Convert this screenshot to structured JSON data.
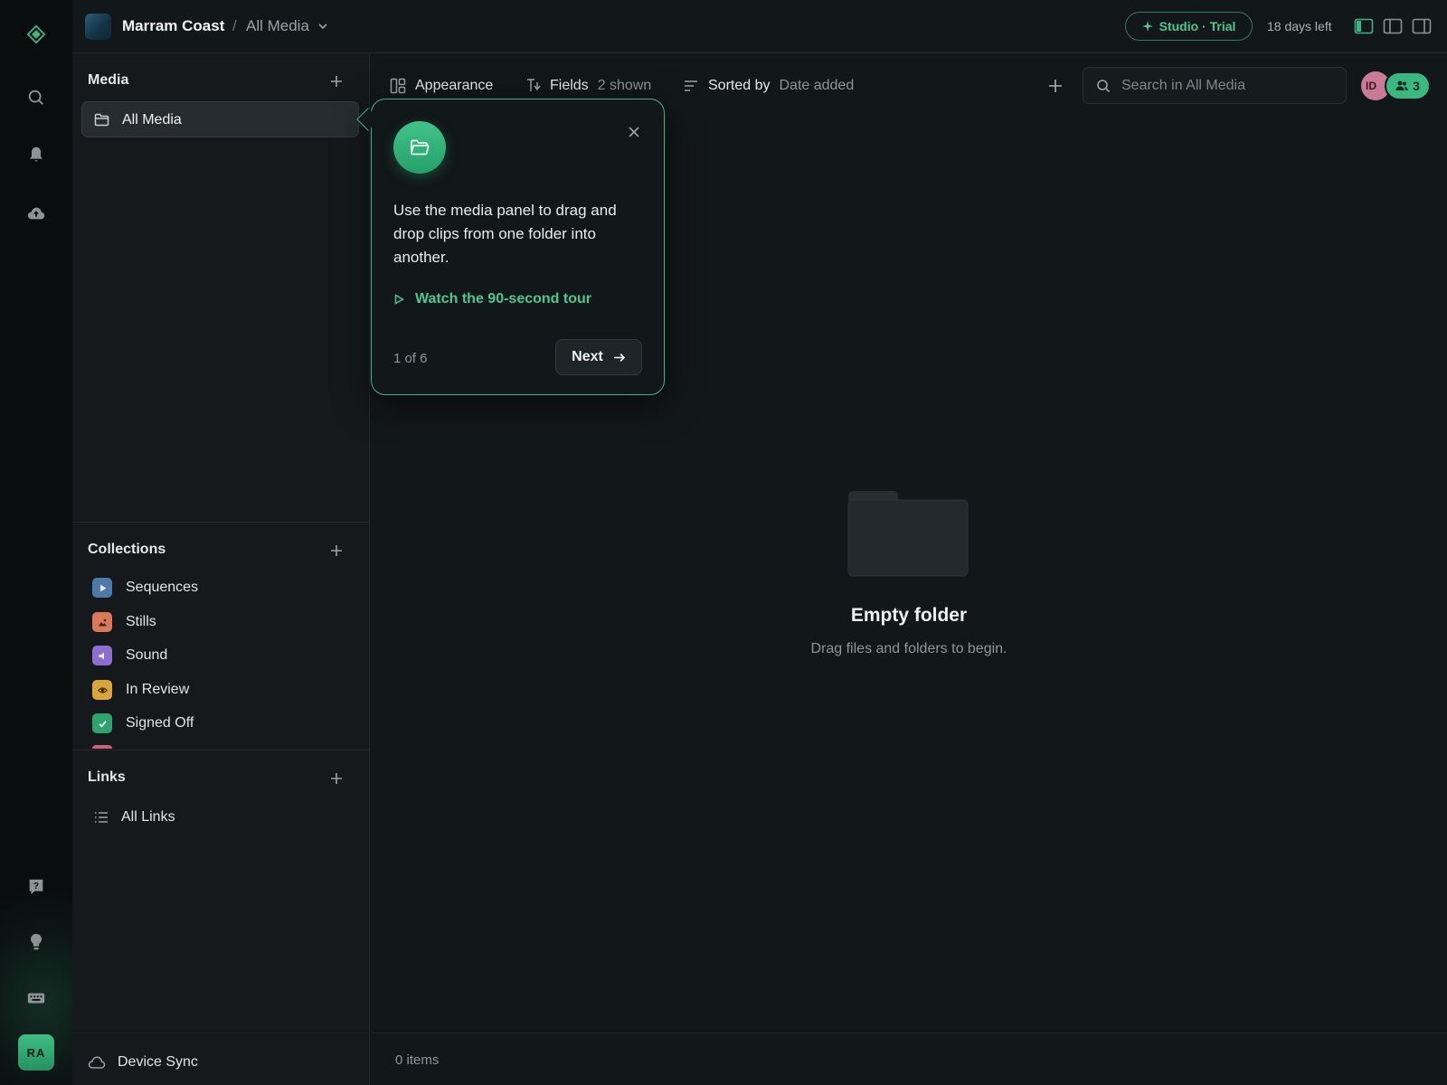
{
  "topbar": {
    "project": "Marram Coast",
    "separator": "/",
    "current": "All Media",
    "trial_label": "Studio · Trial",
    "days_left": "18 days left"
  },
  "rail": {
    "icons": [
      "logo-icon",
      "search-icon",
      "bell-icon",
      "cloud-upload-icon",
      "help-icon",
      "lightbulb-icon",
      "keyboard-icon"
    ],
    "user_initials": "RA"
  },
  "sidebar": {
    "media_title": "Media",
    "all_media": "All Media",
    "collections_title": "Collections",
    "collections": [
      {
        "label": "Sequences",
        "color": "#4d7aa6",
        "icon": "play-icon"
      },
      {
        "label": "Stills",
        "color": "#d9795a",
        "icon": "image-icon"
      },
      {
        "label": "Sound",
        "color": "#8a6fcf",
        "icon": "speaker-icon"
      },
      {
        "label": "In Review",
        "color": "#d9a63a",
        "icon": "eye-icon"
      },
      {
        "label": "Signed Off",
        "color": "#2fa36e",
        "icon": "check-icon"
      }
    ],
    "links_title": "Links",
    "all_links": "All Links",
    "device_sync": "Device Sync"
  },
  "toolbar": {
    "appearance": "Appearance",
    "fields_label": "Fields",
    "fields_value": "2 shown",
    "sorted_label": "Sorted by",
    "sorted_value": "Date added",
    "search_placeholder": "Search in All Media",
    "avatar_initials": "ID",
    "member_count": "3"
  },
  "empty": {
    "title": "Empty folder",
    "subtitle": "Drag files and folders to begin."
  },
  "status": {
    "item_count": "0 items"
  },
  "coachmark": {
    "body": "Use the media panel to drag and drop clips from one folder into another.",
    "link": "Watch the 90-second tour",
    "step": "1 of 6",
    "next": "Next"
  },
  "colors": {
    "accent": "#3fb483",
    "background": "#121719",
    "rail": "#0a0d0e"
  }
}
